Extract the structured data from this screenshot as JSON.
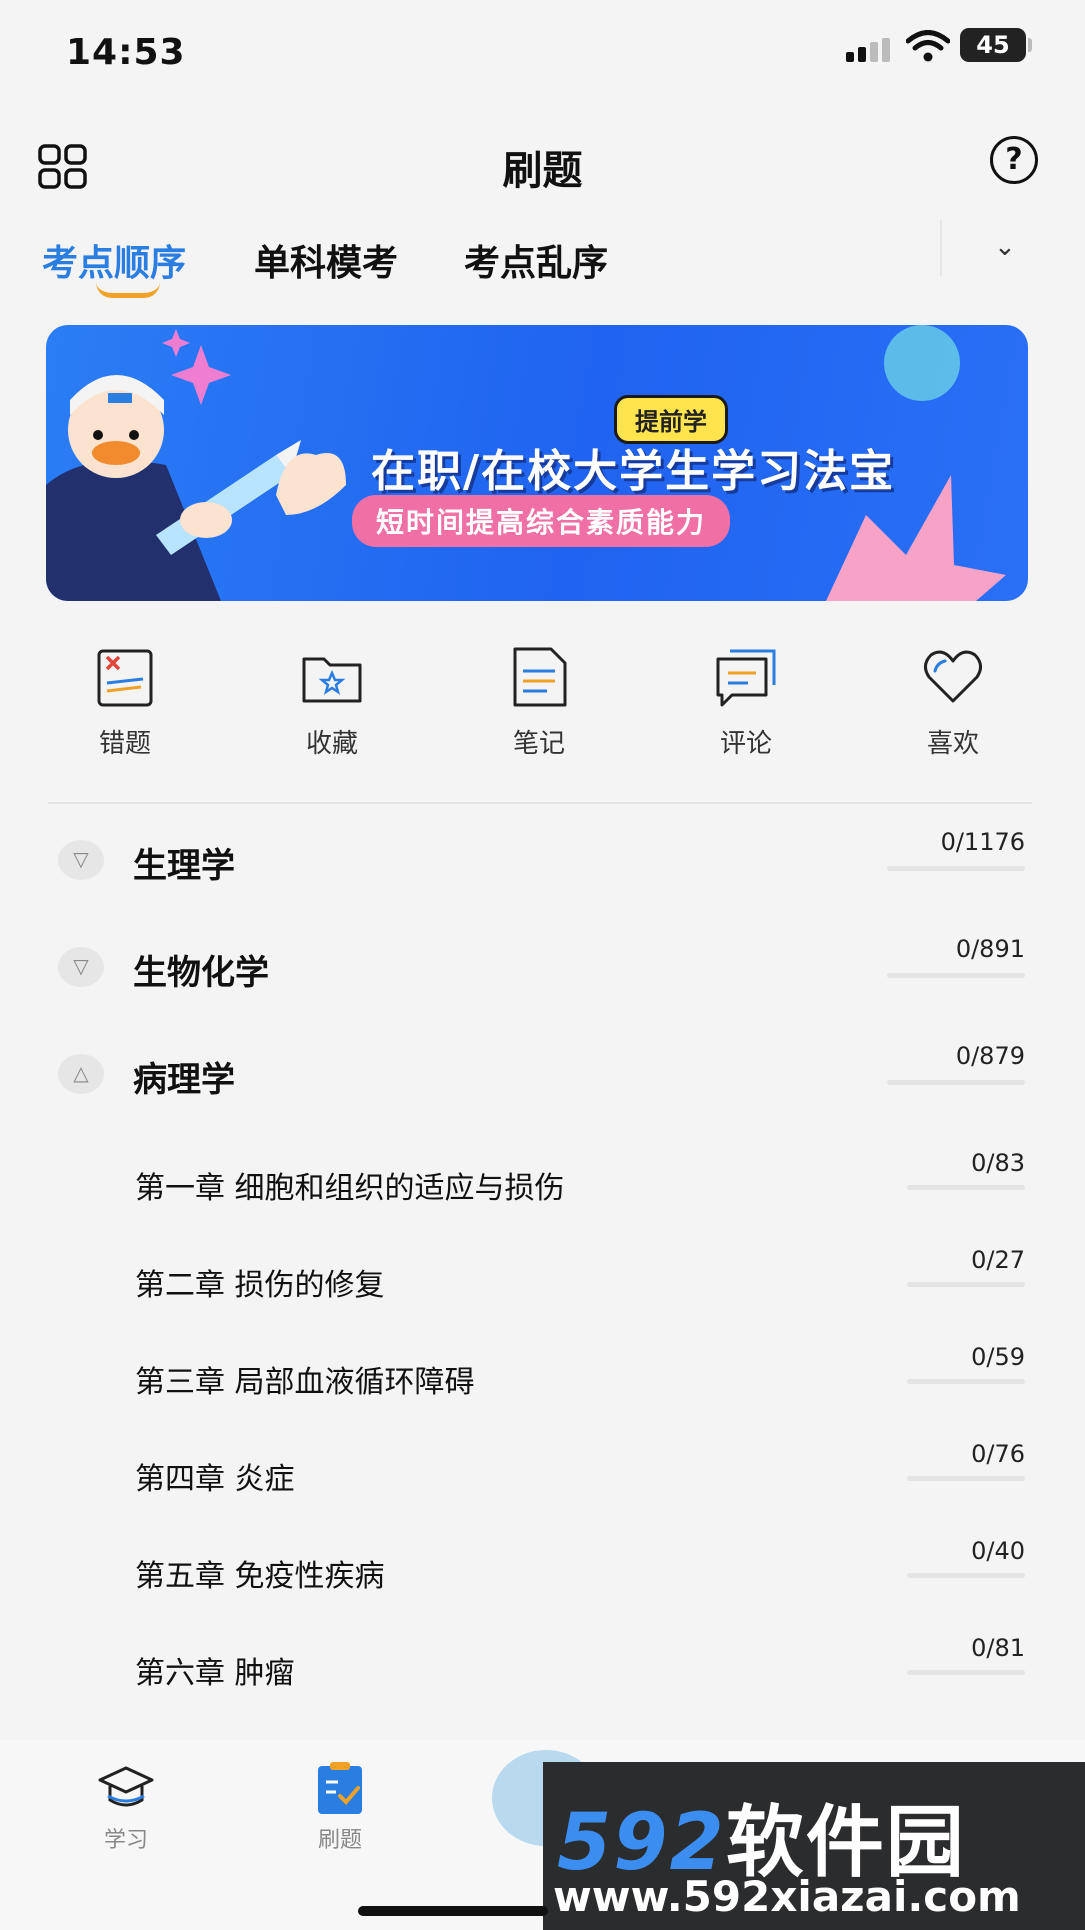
{
  "status_bar": {
    "time": "14:53",
    "battery": "45"
  },
  "header": {
    "title": "刷题",
    "help_icon": "question-icon",
    "menu_icon": "grid-icon"
  },
  "tabs": [
    {
      "label": "考点顺序",
      "active": true
    },
    {
      "label": "单科模考",
      "active": false
    },
    {
      "label": "考点乱序",
      "active": false
    }
  ],
  "banner": {
    "badge": "提前学",
    "title": "在职/在校大学生学习法宝",
    "subtitle": "短时间提高综合素质能力"
  },
  "shortcuts": [
    {
      "label": "错题",
      "icon": "wrong-questions-icon"
    },
    {
      "label": "收藏",
      "icon": "favorites-folder-icon"
    },
    {
      "label": "笔记",
      "icon": "notes-icon"
    },
    {
      "label": "评论",
      "icon": "comments-icon"
    },
    {
      "label": "喜欢",
      "icon": "heart-icon"
    }
  ],
  "subjects": [
    {
      "name": "生理学",
      "count": "0/1176",
      "expanded": false
    },
    {
      "name": "生物化学",
      "count": "0/891",
      "expanded": false
    },
    {
      "name": "病理学",
      "count": "0/879",
      "expanded": true
    }
  ],
  "chapters": [
    {
      "name": "第一章 细胞和组织的适应与损伤",
      "count": "0/83"
    },
    {
      "name": "第二章 损伤的修复",
      "count": "0/27"
    },
    {
      "name": "第三章 局部血液循环障碍",
      "count": "0/59"
    },
    {
      "name": "第四章 炎症",
      "count": "0/76"
    },
    {
      "name": "第五章 免疫性疾病",
      "count": "0/40"
    },
    {
      "name": "第六章 肿瘤",
      "count": "0/81"
    }
  ],
  "bottom_nav": [
    {
      "label": "学习",
      "icon": "graduation-cap-icon"
    },
    {
      "label": "刷题",
      "icon": "clipboard-check-icon",
      "active": true
    }
  ],
  "watermark": {
    "logo_number": "592",
    "logo_text": "软件园",
    "url": "www.592xiazai.com"
  },
  "colors": {
    "accent": "#2a7de1",
    "tab_underline": "#f0a126",
    "banner": "#1f63f0"
  }
}
